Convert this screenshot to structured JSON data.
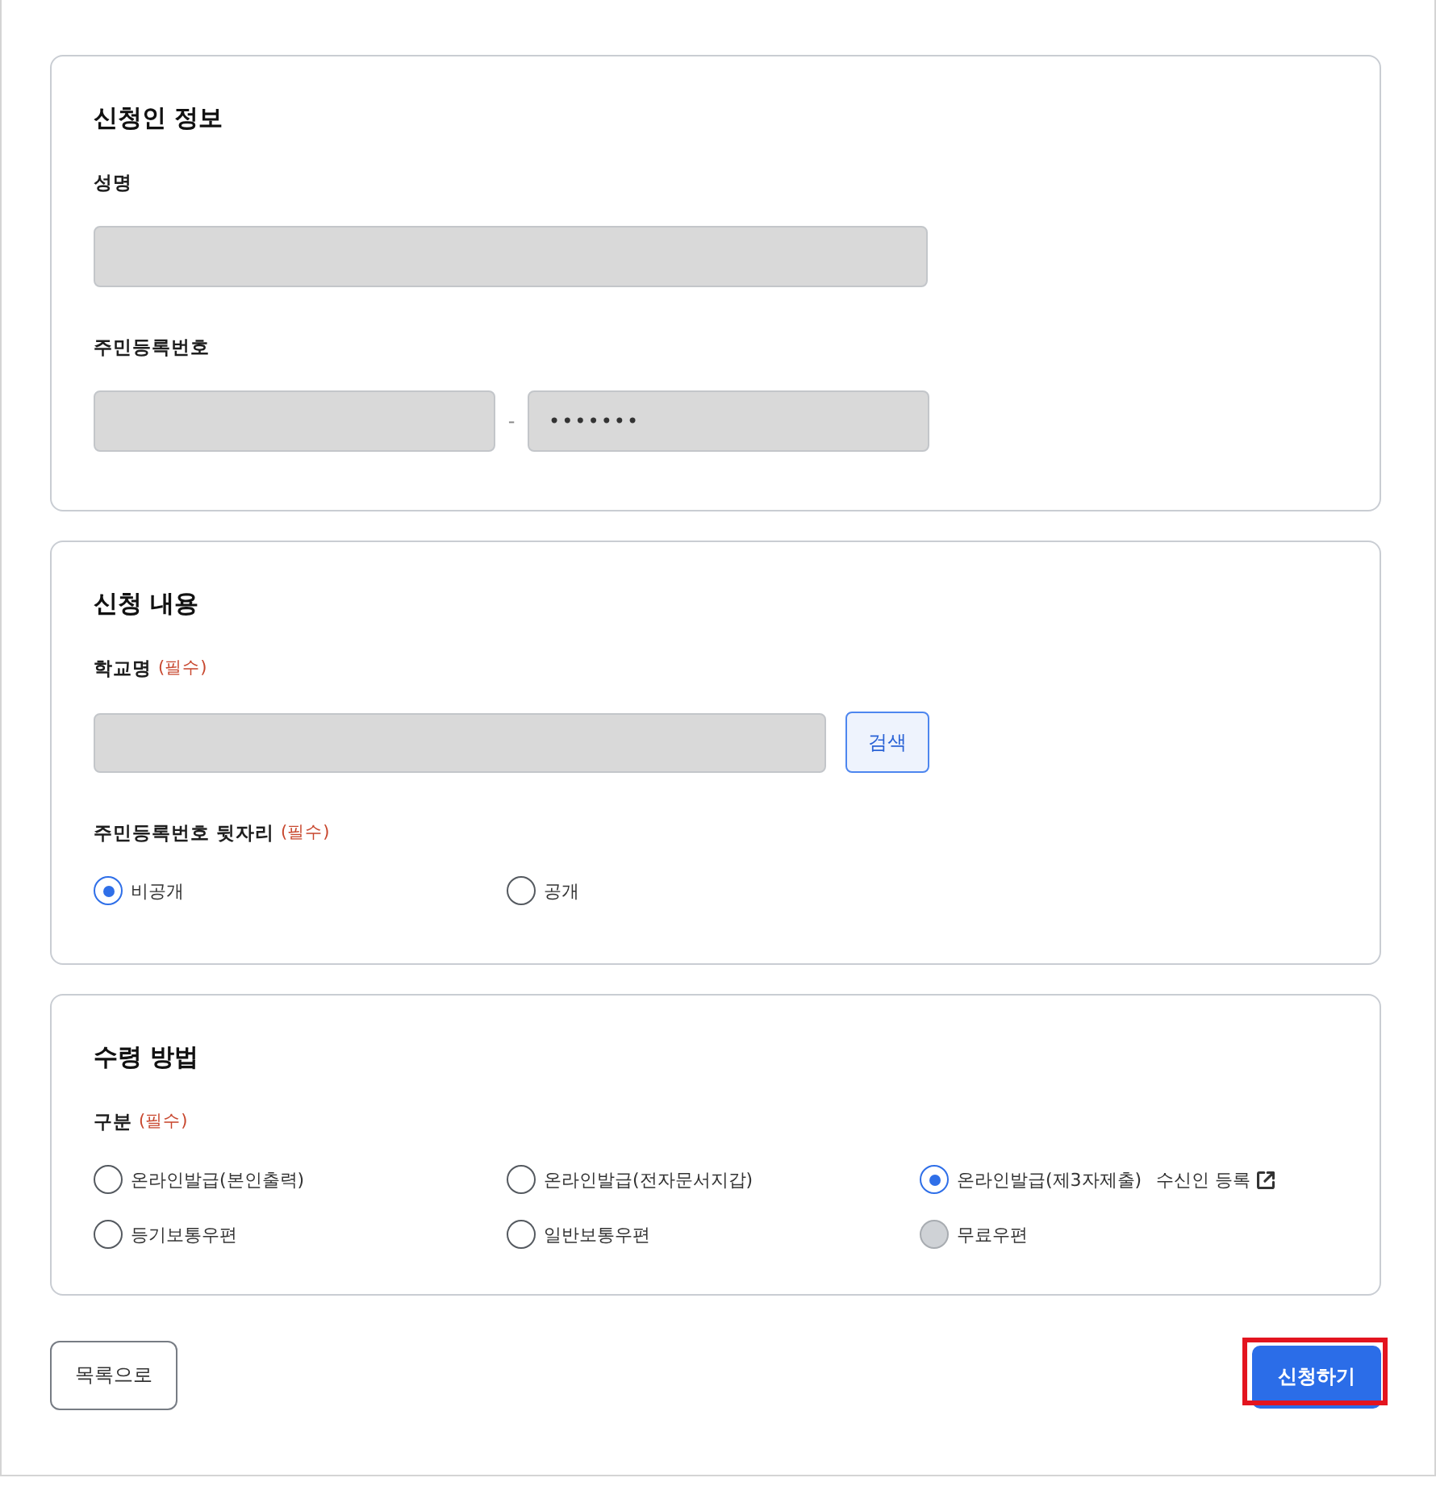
{
  "sections": [
    {
      "title": "신청인 정보",
      "fields": [
        {
          "kind": "text",
          "label": "성명",
          "disabled": true
        },
        {
          "kind": "split",
          "label": "주민등록번호",
          "disabled": true,
          "separator": "-",
          "masked_value": "•••••••"
        }
      ]
    },
    {
      "title": "신청 내용",
      "fields": [
        {
          "kind": "search",
          "label": "학교명",
          "required_mark": "(필수)",
          "disabled": true,
          "button": "검색"
        },
        {
          "kind": "radio",
          "label": "주민등록번호 뒷자리",
          "required_mark": "(필수)",
          "options": [
            {
              "label": "비공개",
              "selected": true,
              "disabled": false
            },
            {
              "label": "공개",
              "selected": false,
              "disabled": false
            }
          ]
        }
      ]
    },
    {
      "title": "수령 방법",
      "fields": [
        {
          "kind": "radio",
          "label": "구분",
          "required_mark": "(필수)",
          "options": [
            {
              "label": "온라인발급(본인출력)",
              "selected": false,
              "disabled": false
            },
            {
              "label": "온라인발급(전자문서지갑)",
              "selected": false,
              "disabled": false
            },
            {
              "label": "온라인발급(제3자제출)",
              "selected": true,
              "disabled": false,
              "link": "수신인 등록"
            },
            {
              "label": "등기보통우편",
              "selected": false,
              "disabled": false
            },
            {
              "label": "일반보통우편",
              "selected": false,
              "disabled": false
            },
            {
              "label": "무료우편",
              "selected": false,
              "disabled": true
            }
          ]
        }
      ]
    }
  ],
  "footer": {
    "back_button": "목록으로",
    "submit_button": {
      "label": "신청하기",
      "highlighted": true
    }
  }
}
